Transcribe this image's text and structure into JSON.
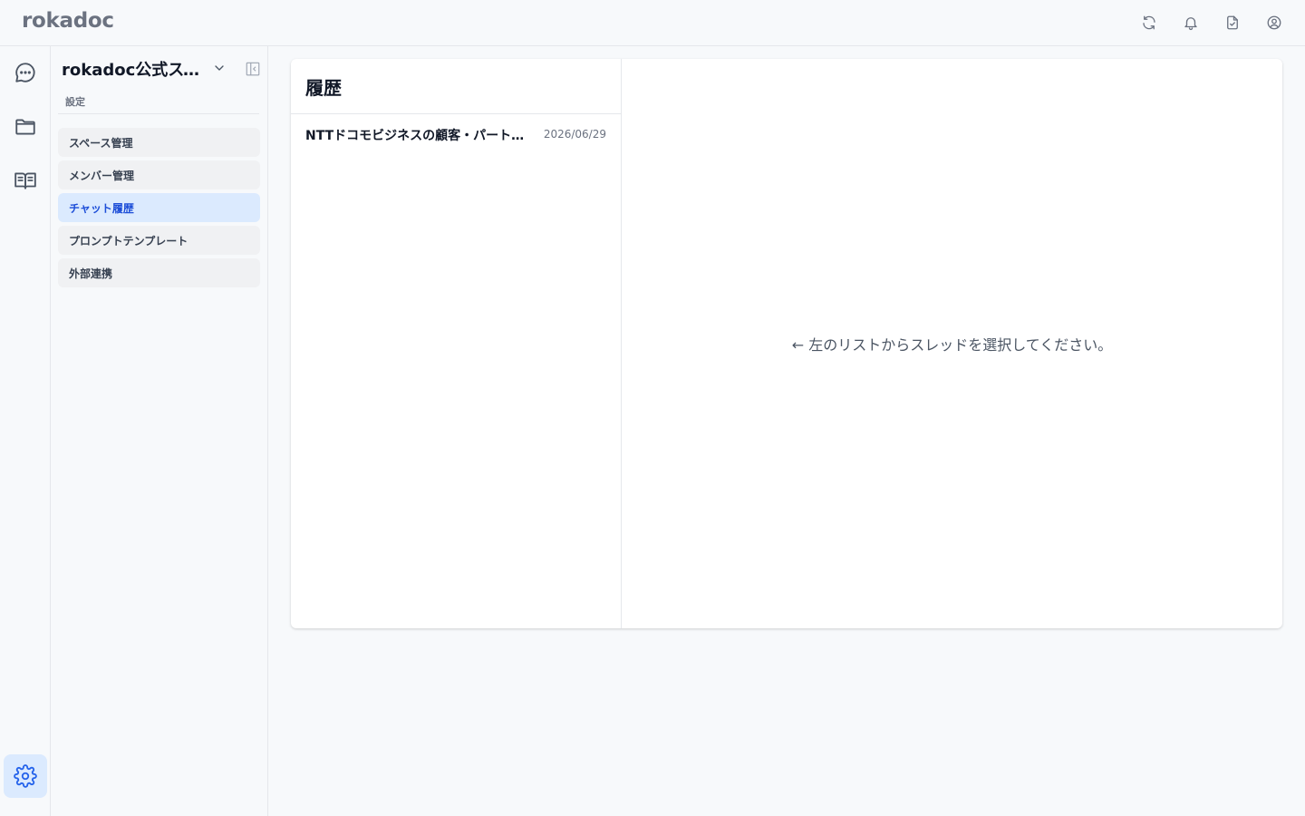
{
  "header": {
    "logo": "rokadoc",
    "icons": [
      "refresh-icon",
      "bell-icon",
      "document-icon",
      "user-circle-icon"
    ]
  },
  "rail": {
    "items": [
      {
        "icon": "chat-bubble-icon"
      },
      {
        "icon": "folder-icon"
      },
      {
        "icon": "book-icon"
      }
    ],
    "settings_icon": "gear-icon"
  },
  "sidebar": {
    "space_name": "rokadoc公式スペース",
    "section_label": "設定",
    "items": [
      {
        "label": "スペース管理",
        "active": false
      },
      {
        "label": "メンバー管理",
        "active": false
      },
      {
        "label": "チャット履歴",
        "active": true
      },
      {
        "label": "プロンプトテンプレート",
        "active": false
      },
      {
        "label": "外部連携",
        "active": false
      }
    ]
  },
  "history": {
    "title": "履歴",
    "threads": [
      {
        "title": "NTTドコモビジネスの顧客・パートナー",
        "date": "2026/06/29"
      }
    ],
    "empty_message": "← 左のリストからスレッドを選択してください。"
  },
  "colors": {
    "accent": "#2563eb",
    "active_bg": "#dbeafe",
    "page_bg": "#f7f9fb"
  }
}
